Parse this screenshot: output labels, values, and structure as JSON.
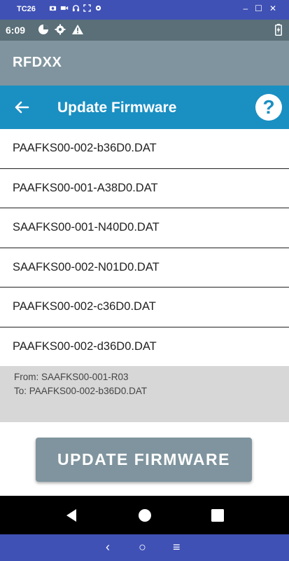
{
  "emulator": {
    "title": "TC26",
    "icons": [
      "camera-icon",
      "video-icon",
      "headset-icon",
      "fullscreen-icon",
      "settings-icon"
    ],
    "window_controls": [
      "minimize-icon",
      "maximize-icon",
      "close-icon"
    ],
    "window_labels": {
      "minimize": "–",
      "maximize": "☐",
      "close": "✕"
    }
  },
  "status_bar": {
    "time": "6:09",
    "icons": [
      "data-saver-icon",
      "settings-icon",
      "warning-icon"
    ],
    "battery_icon": "battery-charging-icon"
  },
  "app_bar": {
    "title": "RFDXX"
  },
  "toolbar": {
    "title": "Update Firmware",
    "back_icon": "arrow-back-icon",
    "help_label": "?"
  },
  "files": [
    "PAAFKS00-002-b36D0.DAT",
    "PAAFKS00-001-A38D0.DAT",
    "SAAFKS00-001-N40D0.DAT",
    "SAAFKS00-002-N01D0.DAT",
    "PAAFKS00-002-c36D0.DAT",
    "PAAFKS00-002-d36D0.DAT"
  ],
  "info": {
    "from": "From: SAAFKS00-001-R03",
    "to": "To: PAAFKS00-002-b36D0.DAT"
  },
  "update_button": {
    "label": "UPDATE FIRMWARE"
  },
  "emulator_nav": {
    "back": "‹",
    "home": "○",
    "menu": "≡"
  },
  "colors": {
    "emulator": "#3f51b5",
    "status_bar": "#5a6f78",
    "app_bar": "#7f949e",
    "toolbar": "#1a8fc2",
    "button": "#7f949e"
  }
}
